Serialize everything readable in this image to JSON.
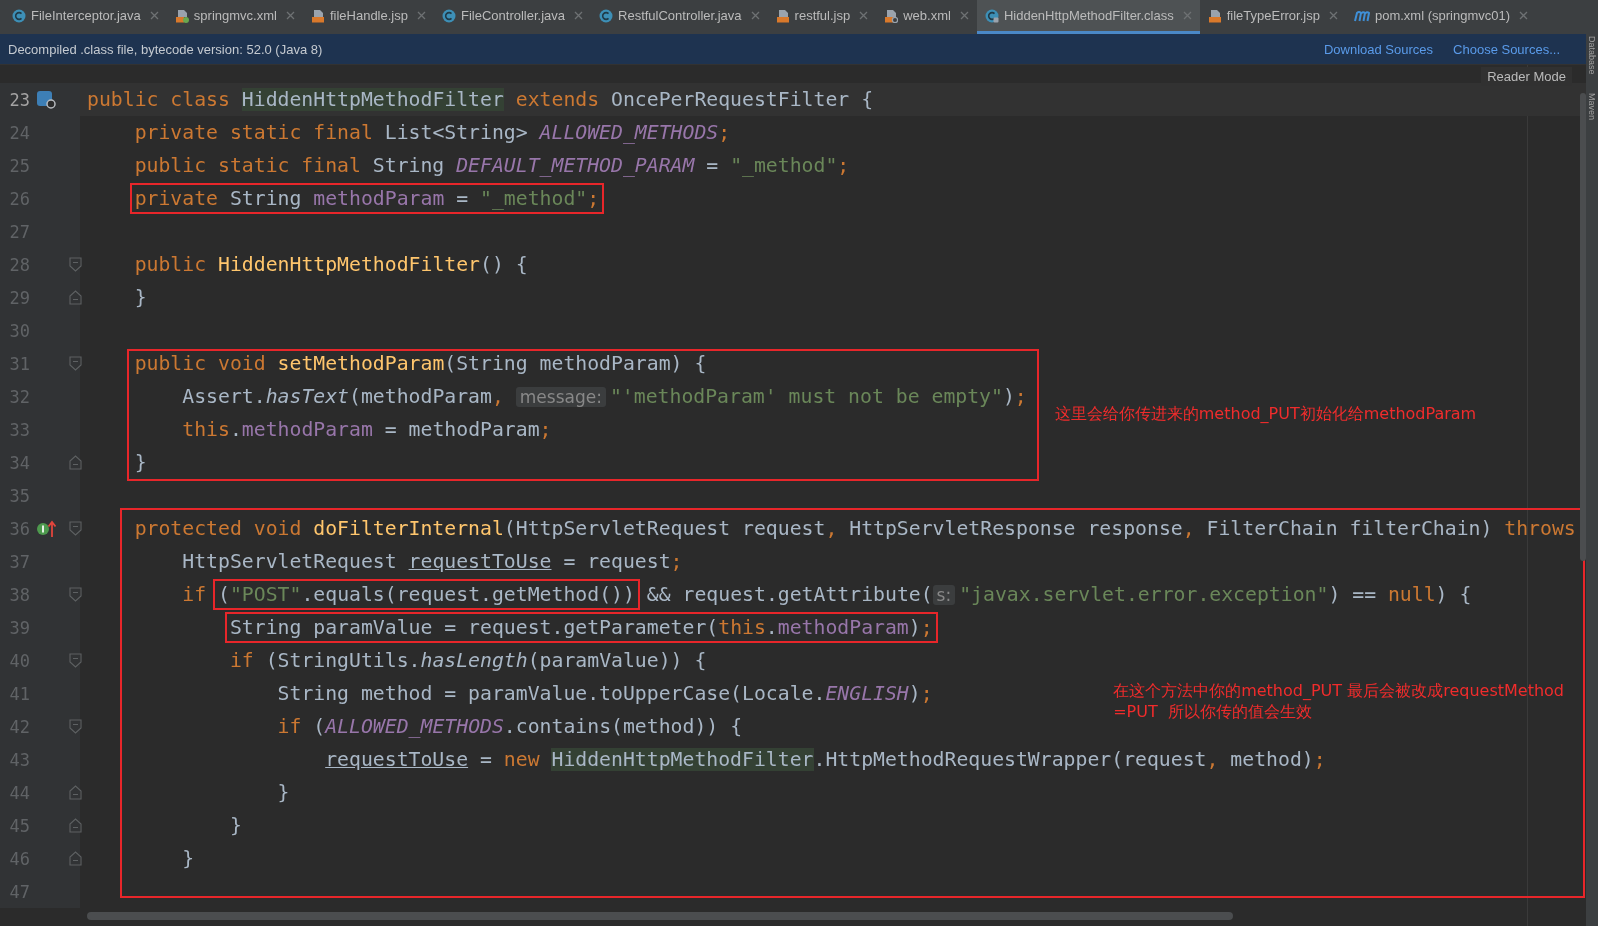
{
  "tabs": [
    {
      "label": "FileInterceptor.java",
      "kind": "java",
      "selected": false
    },
    {
      "label": "springmvc.xml",
      "kind": "spring-xml",
      "selected": false
    },
    {
      "label": "fileHandle.jsp",
      "kind": "jsp",
      "selected": false
    },
    {
      "label": "FileController.java",
      "kind": "java",
      "selected": false
    },
    {
      "label": "RestfulController.java",
      "kind": "java",
      "selected": false
    },
    {
      "label": "restful.jsp",
      "kind": "jsp",
      "selected": false
    },
    {
      "label": "web.xml",
      "kind": "xml",
      "selected": false
    },
    {
      "label": "HiddenHttpMethodFilter.class",
      "kind": "class",
      "selected": true
    },
    {
      "label": "fileTypeError.jsp",
      "kind": "jsp",
      "selected": false
    },
    {
      "label": "pom.xml (springmvc01)",
      "kind": "maven",
      "selected": false
    }
  ],
  "info_bar": {
    "message": "Decompiled .class file, bytecode version: 52.0 (Java 8)",
    "actions": [
      "Download Sources",
      "Choose Sources..."
    ]
  },
  "reader_mode": "Reader Mode",
  "side_tools": [
    "Database",
    "Maven"
  ],
  "editor": {
    "blocks": [
      {
        "kind": "plain",
        "lines": [
          {
            "n": "23",
            "current": true,
            "marker": {
              "kind": "class"
            },
            "segments": [
              {
                "boxed": false,
                "tokens": [
                  {
                    "kind": "kw",
                    "text": "public class "
                  },
                  {
                    "kind": "hl",
                    "text": "HiddenHttpMethodFilter"
                  },
                  {
                    "kind": "kw",
                    "text": " extends "
                  },
                  {
                    "kind": "p",
                    "text": "OncePerRequestFilter {"
                  }
                ]
              }
            ]
          },
          {
            "n": "24",
            "segments": [
              {
                "boxed": false,
                "tokens": [
                  {
                    "kind": "kw",
                    "text": "    private static final "
                  },
                  {
                    "kind": "p",
                    "text": "List<String> "
                  },
                  {
                    "kind": "sf",
                    "text": "ALLOWED_METHODS"
                  },
                  {
                    "kind": "kw",
                    "text": ";"
                  }
                ]
              }
            ]
          },
          {
            "n": "25",
            "segments": [
              {
                "boxed": false,
                "tokens": [
                  {
                    "kind": "kw",
                    "text": "    public static final "
                  },
                  {
                    "kind": "p",
                    "text": "String "
                  },
                  {
                    "kind": "sf",
                    "text": "DEFAULT_METHOD_PARAM"
                  },
                  {
                    "kind": "p",
                    "text": " = "
                  },
                  {
                    "kind": "s",
                    "text": "\"_method\""
                  },
                  {
                    "kind": "kw",
                    "text": ";"
                  }
                ]
              }
            ]
          },
          {
            "n": "26",
            "segments": [
              {
                "boxed": true,
                "tokens": [
                  {
                    "kind": "kw",
                    "text": "    private "
                  },
                  {
                    "kind": "p",
                    "text": "String "
                  },
                  {
                    "kind": "f",
                    "text": "methodParam"
                  },
                  {
                    "kind": "p",
                    "text": " = "
                  },
                  {
                    "kind": "s",
                    "text": "\"_method\""
                  },
                  {
                    "kind": "kw",
                    "text": ";"
                  }
                ]
              }
            ]
          },
          {
            "n": "27"
          },
          {
            "n": "28",
            "fold": {
              "kind": "start"
            },
            "segments": [
              {
                "boxed": false,
                "tokens": [
                  {
                    "kind": "kw",
                    "text": "    public "
                  },
                  {
                    "kind": "m",
                    "text": "HiddenHttpMethodFilter"
                  },
                  {
                    "kind": "p",
                    "text": "() {"
                  }
                ]
              }
            ]
          },
          {
            "n": "29",
            "fold": {
              "kind": "end"
            },
            "segments": [
              {
                "boxed": false,
                "tokens": [
                  {
                    "kind": "p",
                    "text": "    }"
                  }
                ]
              }
            ]
          },
          {
            "n": "30"
          }
        ]
      },
      {
        "kind": "side-note",
        "note": "这里会给你传进来的method_PUT初始化给methodParam",
        "lines": [
          {
            "n": "31",
            "fold": {
              "kind": "start"
            },
            "segments": [
              {
                "boxed": false,
                "tokens": [
                  {
                    "kind": "kw",
                    "text": "    public void "
                  },
                  {
                    "kind": "m",
                    "text": "setMethodParam"
                  },
                  {
                    "kind": "p",
                    "text": "(String methodParam) {"
                  }
                ]
              }
            ]
          },
          {
            "n": "32",
            "segments": [
              {
                "boxed": false,
                "tokens": [
                  {
                    "kind": "p",
                    "text": "        Assert."
                  },
                  {
                    "kind": "sm",
                    "text": "hasText"
                  },
                  {
                    "kind": "p",
                    "text": "(methodParam"
                  },
                  {
                    "kind": "kw",
                    "text": ", "
                  },
                  {
                    "kind": "hint",
                    "text": "message:"
                  },
                  {
                    "kind": "s",
                    "text": "\"'methodParam' must not be empty\""
                  },
                  {
                    "kind": "p",
                    "text": ")"
                  },
                  {
                    "kind": "kw",
                    "text": ";"
                  }
                ]
              }
            ]
          },
          {
            "n": "33",
            "segments": [
              {
                "boxed": false,
                "tokens": [
                  {
                    "kind": "kw",
                    "text": "        this"
                  },
                  {
                    "kind": "p",
                    "text": "."
                  },
                  {
                    "kind": "f",
                    "text": "methodParam"
                  },
                  {
                    "kind": "p",
                    "text": " = methodParam"
                  },
                  {
                    "kind": "kw",
                    "text": ";"
                  }
                ]
              }
            ]
          },
          {
            "n": "34",
            "fold": {
              "kind": "end"
            },
            "segments": [
              {
                "boxed": false,
                "tokens": [
                  {
                    "kind": "p",
                    "text": "    }"
                  }
                ]
              }
            ]
          }
        ]
      },
      {
        "kind": "plain",
        "lines": [
          {
            "n": "35"
          }
        ]
      },
      {
        "kind": "inner-note",
        "note": "在这个方法中你的method_PUT 最后会被改成requestMethod\n=PUT  所以你传的值会生效",
        "lines": [
          {
            "n": "36",
            "fold": {
              "kind": "start"
            },
            "marker": {
              "kind": "override"
            },
            "segments": [
              {
                "boxed": false,
                "tokens": [
                  {
                    "kind": "kw",
                    "text": "    protected void "
                  },
                  {
                    "kind": "m",
                    "text": "doFilterInternal"
                  },
                  {
                    "kind": "p",
                    "text": "(HttpServletRequest request"
                  },
                  {
                    "kind": "kw",
                    "text": ","
                  },
                  {
                    "kind": "p",
                    "text": " HttpServletResponse response"
                  },
                  {
                    "kind": "kw",
                    "text": ","
                  },
                  {
                    "kind": "p",
                    "text": " FilterChain filterChain) "
                  },
                  {
                    "kind": "kw",
                    "text": "throws"
                  }
                ]
              }
            ]
          },
          {
            "n": "37",
            "segments": [
              {
                "boxed": false,
                "tokens": [
                  {
                    "kind": "p",
                    "text": "        HttpServletRequest "
                  },
                  {
                    "kind": "u",
                    "text": "requestToUse"
                  },
                  {
                    "kind": "p",
                    "text": " = request"
                  },
                  {
                    "kind": "kw",
                    "text": ";"
                  }
                ]
              }
            ]
          },
          {
            "n": "38",
            "fold": {
              "kind": "start"
            },
            "segments": [
              {
                "boxed": false,
                "tokens": [
                  {
                    "kind": "kw",
                    "text": "        if "
                  }
                ]
              },
              {
                "boxed": true,
                "tokens": [
                  {
                    "kind": "p",
                    "text": "("
                  },
                  {
                    "kind": "s",
                    "text": "\"POST\""
                  },
                  {
                    "kind": "p",
                    "text": ".equals(request.getMethod())"
                  }
                ]
              },
              {
                "boxed": false,
                "tokens": [
                  {
                    "kind": "p",
                    "text": " && request.getAttribute("
                  },
                  {
                    "kind": "hint",
                    "text": "s:"
                  },
                  {
                    "kind": "s",
                    "text": "\"javax.servlet.error.exception\""
                  },
                  {
                    "kind": "p",
                    "text": ") == "
                  },
                  {
                    "kind": "kw",
                    "text": "null"
                  },
                  {
                    "kind": "p",
                    "text": ") {"
                  }
                ]
              }
            ]
          },
          {
            "n": "39",
            "segments": [
              {
                "boxed": true,
                "tokens": [
                  {
                    "kind": "p",
                    "text": "            String paramValue = request.getParameter("
                  },
                  {
                    "kind": "kw",
                    "text": "this"
                  },
                  {
                    "kind": "p",
                    "text": "."
                  },
                  {
                    "kind": "f",
                    "text": "methodParam"
                  },
                  {
                    "kind": "p",
                    "text": ")"
                  },
                  {
                    "kind": "kw",
                    "text": ";"
                  }
                ]
              }
            ]
          },
          {
            "n": "40",
            "fold": {
              "kind": "start"
            },
            "segments": [
              {
                "boxed": false,
                "tokens": [
                  {
                    "kind": "kw",
                    "text": "            if "
                  },
                  {
                    "kind": "p",
                    "text": "(StringUtils."
                  },
                  {
                    "kind": "sm",
                    "text": "hasLength"
                  },
                  {
                    "kind": "p",
                    "text": "(paramValue)) {"
                  }
                ]
              }
            ]
          },
          {
            "n": "41",
            "segments": [
              {
                "boxed": false,
                "tokens": [
                  {
                    "kind": "p",
                    "text": "                String method = paramValue.toUpperCase(Locale."
                  },
                  {
                    "kind": "sf",
                    "text": "ENGLISH"
                  },
                  {
                    "kind": "p",
                    "text": ")"
                  },
                  {
                    "kind": "kw",
                    "text": ";"
                  }
                ]
              }
            ]
          },
          {
            "n": "42",
            "fold": {
              "kind": "start"
            },
            "segments": [
              {
                "boxed": false,
                "tokens": [
                  {
                    "kind": "kw",
                    "text": "                if "
                  },
                  {
                    "kind": "p",
                    "text": "("
                  },
                  {
                    "kind": "sf",
                    "text": "ALLOWED_METHODS"
                  },
                  {
                    "kind": "p",
                    "text": ".contains(method)) {"
                  }
                ]
              }
            ]
          },
          {
            "n": "43",
            "segments": [
              {
                "boxed": false,
                "tokens": [
                  {
                    "kind": "u",
                    "text": "                    requestToUse"
                  },
                  {
                    "kind": "p",
                    "text": " = "
                  },
                  {
                    "kind": "kw",
                    "text": "new "
                  },
                  {
                    "kind": "hl",
                    "text": "HiddenHttpMethodFilter"
                  },
                  {
                    "kind": "p",
                    "text": ".HttpMethodRequestWrapper(request"
                  },
                  {
                    "kind": "kw",
                    "text": ","
                  },
                  {
                    "kind": "p",
                    "text": " method)"
                  },
                  {
                    "kind": "kw",
                    "text": ";"
                  }
                ]
              }
            ]
          },
          {
            "n": "44",
            "fold": {
              "kind": "end"
            },
            "segments": [
              {
                "boxed": false,
                "tokens": [
                  {
                    "kind": "p",
                    "text": "                }"
                  }
                ]
              }
            ]
          },
          {
            "n": "45",
            "fold": {
              "kind": "end"
            },
            "segments": [
              {
                "boxed": false,
                "tokens": [
                  {
                    "kind": "p",
                    "text": "            }"
                  }
                ]
              }
            ]
          },
          {
            "n": "46",
            "fold": {
              "kind": "end"
            },
            "segments": [
              {
                "boxed": false,
                "tokens": [
                  {
                    "kind": "p",
                    "text": "        }"
                  }
                ]
              }
            ]
          },
          {
            "n": "47"
          }
        ]
      }
    ]
  }
}
